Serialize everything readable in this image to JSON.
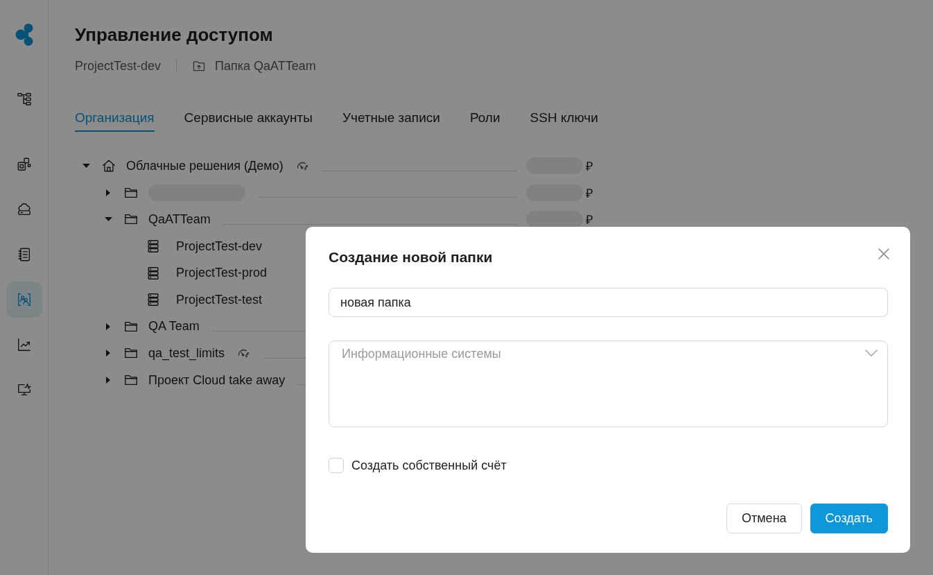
{
  "sidebar": {
    "items": [
      {
        "kind": "hierarchy",
        "selected": false
      },
      {
        "kind": "resources",
        "selected": false
      },
      {
        "kind": "cloud",
        "selected": false
      },
      {
        "kind": "journal",
        "selected": false
      },
      {
        "kind": "access",
        "selected": true
      },
      {
        "kind": "analytics",
        "selected": false
      },
      {
        "kind": "monitoring",
        "selected": false
      }
    ]
  },
  "header": {
    "title": "Управление доступом",
    "breadcrumbs": [
      {
        "kind": "project",
        "label": "ProjectTest-dev"
      },
      {
        "kind": "folder",
        "label": "Папка QaATTeam"
      }
    ]
  },
  "tabs": [
    {
      "label": "Организация",
      "selected": true
    },
    {
      "label": "Сервисные аккаунты",
      "selected": false
    },
    {
      "label": "Учетные записи",
      "selected": false
    },
    {
      "label": "Роли",
      "selected": false
    },
    {
      "label": "SSH ключи",
      "selected": false
    }
  ],
  "tree": {
    "items": [
      {
        "kind": "home",
        "name": "Облачные решения (Демо)",
        "expanded": true,
        "limits": true,
        "amount_blurred": true,
        "currency": "₽",
        "children": [
          {
            "kind": "folder",
            "name_blurred": true,
            "expanded": false,
            "limits": false,
            "amount_blurred": true,
            "currency": "₽"
          },
          {
            "kind": "folder",
            "name": "QaATTeam",
            "expanded": true,
            "limits": false,
            "amount_blurred": true,
            "currency": "₽",
            "children": [
              {
                "kind": "project",
                "name": "ProjectTest-dev"
              },
              {
                "kind": "project",
                "name": "ProjectTest-prod"
              },
              {
                "kind": "project",
                "name": "ProjectTest-test"
              }
            ]
          },
          {
            "kind": "folder",
            "name": "QA Team",
            "expanded": false,
            "limits": false
          },
          {
            "kind": "folder",
            "name": "qa_test_limits",
            "expanded": false,
            "limits": true
          },
          {
            "kind": "folder",
            "name": "Проект Cloud take away",
            "expanded": false,
            "limits": false
          }
        ]
      }
    ]
  },
  "dialog": {
    "title": "Создание новой папки",
    "name_field": {
      "value": "новая папка"
    },
    "systems_field": {
      "placeholder": "Информационные системы"
    },
    "own_account": {
      "label": "Создать собственный счёт",
      "checked": false
    },
    "buttons": [
      {
        "kind": "cancel",
        "label": "Отмена"
      },
      {
        "kind": "submit",
        "label": "Создать"
      }
    ]
  }
}
